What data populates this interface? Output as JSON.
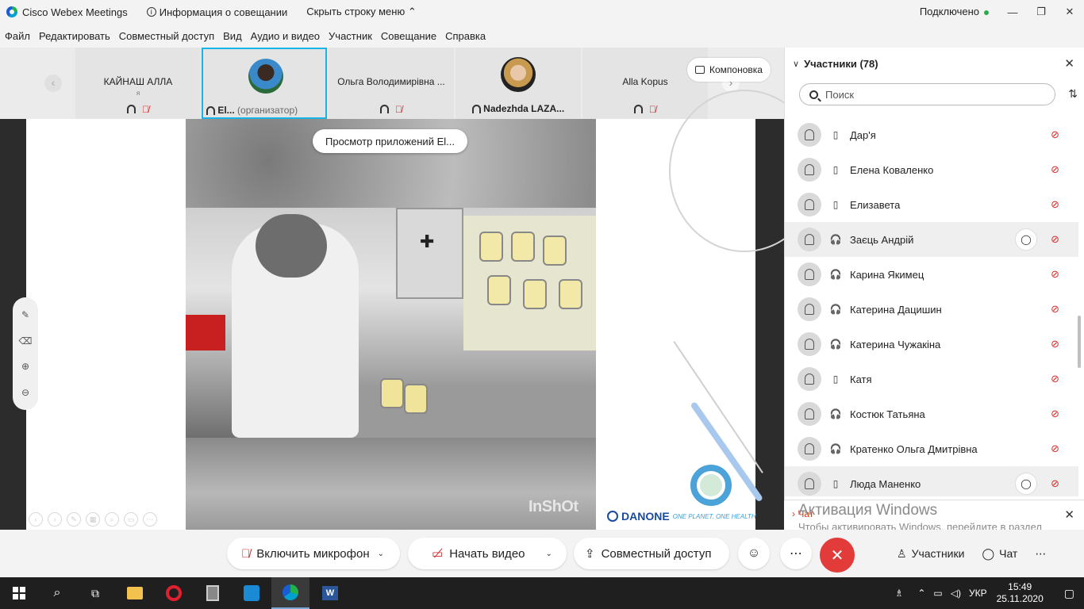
{
  "window": {
    "title": "Cisco Webex Meetings",
    "info": "Информация о совещании",
    "hide_menu": "Скрыть строку меню",
    "status": "Подключено",
    "minimize": "—",
    "maximize": "❐",
    "close": "✕"
  },
  "menu": [
    "Файл",
    "Редактировать",
    "Совместный доступ",
    "Вид",
    "Аудио и видео",
    "Участник",
    "Совещание",
    "Справка"
  ],
  "thumbnails": [
    {
      "name": "КАЙНАШ АЛЛА",
      "sub": "я",
      "bottom": ""
    },
    {
      "name": "",
      "sub": "",
      "bottom": "El...",
      "bottom_extra": "(организатор)"
    },
    {
      "name": "Ольга Володимирівна ...",
      "sub": "",
      "bottom": ""
    },
    {
      "name": "",
      "sub": "",
      "bottom": "Nadezhda LAZA..."
    },
    {
      "name": "Alla Kopus",
      "sub": "",
      "bottom": ""
    }
  ],
  "layout_button": "Компоновка",
  "stage": {
    "app_view_pill": "Просмотр приложений El...",
    "watermark": "InShOt",
    "brand": "DANONE",
    "slogan": "ONE PLANET. ONE HEALTH"
  },
  "panel": {
    "title": "Участники (78)",
    "search_placeholder": "Поиск",
    "participants": [
      {
        "name": "Дар'я",
        "device": "phone",
        "highlight": false,
        "chat": false
      },
      {
        "name": "Елена Коваленко",
        "device": "phone",
        "highlight": false,
        "chat": false
      },
      {
        "name": "Елизавета",
        "device": "phone",
        "highlight": false,
        "chat": false
      },
      {
        "name": "Заєць Андрій",
        "device": "headset",
        "highlight": true,
        "chat": true
      },
      {
        "name": "Карина Якимец",
        "device": "headset",
        "highlight": false,
        "chat": false
      },
      {
        "name": "Катерина Дацишин",
        "device": "headset",
        "highlight": false,
        "chat": false
      },
      {
        "name": "Катерина Чужакіна",
        "device": "headset",
        "highlight": false,
        "chat": false
      },
      {
        "name": "Катя",
        "device": "phone",
        "highlight": false,
        "chat": false
      },
      {
        "name": "Костюк Татьяна",
        "device": "headset",
        "highlight": false,
        "chat": false
      },
      {
        "name": "Кратенко Ольга Дмитрівна",
        "device": "headset",
        "highlight": false,
        "chat": false
      },
      {
        "name": "Люда Маненко",
        "device": "phone",
        "highlight": true,
        "chat": true
      }
    ],
    "chat_label": "Чат",
    "activation_title": "Активация Windows",
    "activation_text": "Чтобы активировать Windows, перейдите в раздел \"Параметры\"."
  },
  "controls": {
    "mic": "Включить микрофон",
    "video": "Начать видео",
    "share": "Совместный доступ",
    "participants": "Участники",
    "chat": "Чат"
  },
  "taskbar": {
    "lang": "УКР",
    "time": "15:49",
    "date": "25.11.2020"
  },
  "colors": {
    "accent": "#18b4e6",
    "leave": "#e33a3a",
    "muted": "#d62929",
    "status_ok": "#2fa84f"
  }
}
